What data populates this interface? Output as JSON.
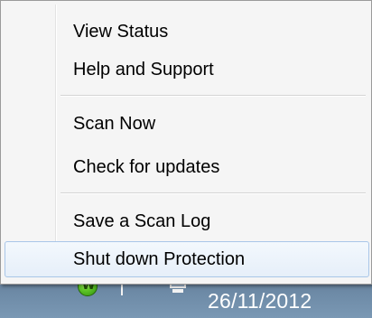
{
  "menu": {
    "items": [
      {
        "label": "View Status"
      },
      {
        "label": "Help and Support"
      },
      {
        "label": "Scan Now"
      },
      {
        "label": "Check for updates"
      },
      {
        "label": "Save a Scan Log"
      },
      {
        "label": "Shut down Protection"
      }
    ],
    "highlighted_item": "Shut down Protection"
  },
  "taskbar": {
    "date": "26/11/2012",
    "tray_icons": [
      "webroot-w-icon",
      "action-center-flag-icon",
      "network-monitor-icon"
    ],
    "tray_app_letter": "W"
  },
  "colors": {
    "menu_background": "#f5f5f5",
    "highlight_border": "#a9c6e8",
    "taskbar": "#6d8aa6"
  }
}
